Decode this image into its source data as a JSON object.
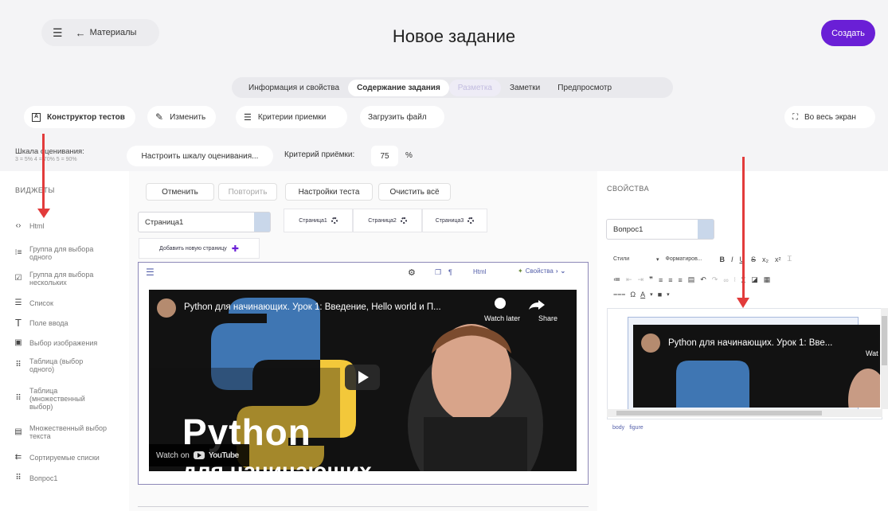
{
  "header": {
    "back_label": "Материалы",
    "title": "Новое задание",
    "create_label": "Создать"
  },
  "tabs": [
    {
      "label": "Информация и свойства"
    },
    {
      "label": "Содержание задания"
    },
    {
      "label": "Разметка"
    },
    {
      "label": "Заметки"
    },
    {
      "label": "Предпросмотр"
    }
  ],
  "toolbar": {
    "builder_label": "Конструктор тестов",
    "edit_label": "Изменить",
    "criteria_label": "Критерии приемки",
    "upload_label": "Загрузить файл",
    "fullscreen_label": "Во весь экран"
  },
  "scale": {
    "label": "Шкала оценивания:",
    "sub": "3 = 5%  4 = 70%  5 = 90%",
    "configure_label": "Настроить шкалу оценивания...",
    "criterion_label": "Критерий приёмки:",
    "criterion_value": "75",
    "percent": "%"
  },
  "widgets": {
    "title": "ВИДЖЕТЫ",
    "items": [
      {
        "label": "Html",
        "icon": "code-icon"
      },
      {
        "label": "Группа для выбора одного",
        "icon": "radio-list-icon"
      },
      {
        "label": "Группа для выбора нескольких",
        "icon": "checkbox-icon"
      },
      {
        "label": "Список",
        "icon": "list-icon"
      },
      {
        "label": "Поле ввода",
        "icon": "text-field-icon"
      },
      {
        "label": "Выбор изображения",
        "icon": "image-icon"
      },
      {
        "label": "Таблица (выбор одного)",
        "icon": "table-icon"
      },
      {
        "label": "Таблица (множественный выбор)",
        "icon": "table-multi-icon"
      },
      {
        "label": "Множественный выбор текста",
        "icon": "text-select-icon"
      },
      {
        "label": "Сортируемые списки",
        "icon": "sortable-icon"
      },
      {
        "label": "Вопрос1",
        "icon": "grid-icon"
      }
    ]
  },
  "center": {
    "cancel_label": "Отменить",
    "redo_label": "Повторить",
    "settings_label": "Настройки теста",
    "clear_label": "Очистить всё",
    "page_select": "Страница1",
    "page_tabs": [
      {
        "label": "Страница1"
      },
      {
        "label": "Страница2"
      },
      {
        "label": "Страница3"
      }
    ],
    "add_page_label": "Добавить новую страницу",
    "html_label": "Html",
    "properties_label": "Свойства"
  },
  "video": {
    "title": "Python для начинающих. Урок 1: Введение, Hello world и П...",
    "watch_later": "Watch later",
    "share": "Share",
    "big_text": "Python",
    "big_text2": "для начинающих",
    "watch_on": "Watch on",
    "youtube": "YouTube"
  },
  "properties": {
    "title": "СВОЙСТВА",
    "select": "Вопрос1",
    "styles_label": "Стили",
    "format_label": "Форматиров...",
    "preview_title": "Python для начинающих. Урок 1: Вве...",
    "preview_wat": "Wat",
    "path_body": "body",
    "path_figure": "figure"
  }
}
